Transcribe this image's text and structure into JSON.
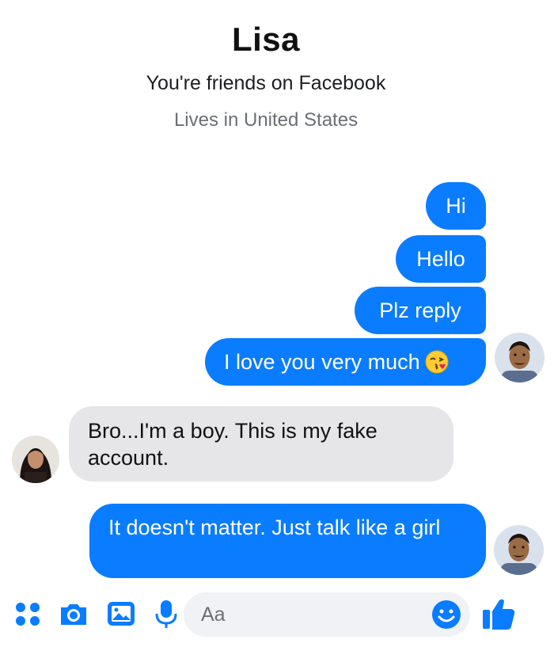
{
  "header": {
    "contact_name": "Lisa",
    "friend_status": "You're friends on Facebook",
    "location": "Lives in United States"
  },
  "messages": [
    {
      "sender": "me",
      "text": "Hi"
    },
    {
      "sender": "me",
      "text": "Hello"
    },
    {
      "sender": "me",
      "text": "Plz reply"
    },
    {
      "sender": "me",
      "text": "I love you very much",
      "emoji": "face-blowing-kiss"
    },
    {
      "sender": "Lisa",
      "text": "Bro...I'm a boy. This is my fake account."
    },
    {
      "sender": "me",
      "text": "It doesn't matter. Just talk like a girl"
    }
  ],
  "composer": {
    "placeholder": "Aa",
    "icons": [
      "more-apps-icon",
      "camera-icon",
      "gallery-icon",
      "microphone-icon",
      "emoji-icon",
      "thumbs-up-icon"
    ]
  },
  "colors": {
    "sent_bubble": "#0a7cff",
    "received_bubble": "#e6e6e9",
    "accent": "#0a7cff"
  }
}
